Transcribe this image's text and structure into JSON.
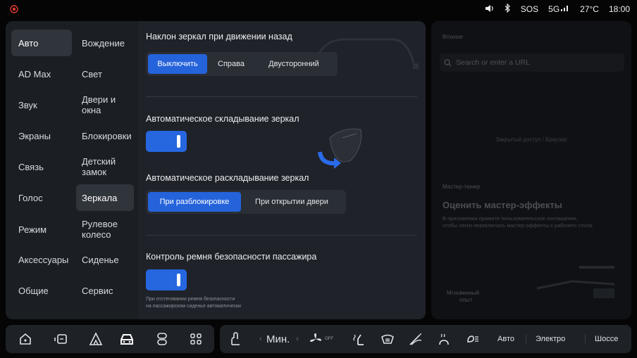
{
  "status": {
    "volume_icon": "volume-icon",
    "bluetooth_icon": "bluetooth-icon",
    "sos": "SOS",
    "network": "5G",
    "temperature": "27°C",
    "time": "18:00"
  },
  "nav_primary": [
    "Авто",
    "AD Max",
    "Звук",
    "Экраны",
    "Связь",
    "Голос",
    "Режим",
    "Аксессуары",
    "Общие"
  ],
  "nav_primary_active": "Авто",
  "nav_secondary": [
    "Вождение",
    "Свет",
    "Двери и окна",
    "Блокировки",
    "Детский замок",
    "Зеркала",
    "Рулевое колесо",
    "Сиденье",
    "Сервис"
  ],
  "nav_secondary_active": "Зеркала",
  "settings": {
    "reverse_tilt": {
      "title": "Наклон зеркал при движении назад",
      "options": [
        "Выключить",
        "Справа",
        "Двусторонний"
      ],
      "selected": "Выключить"
    },
    "auto_fold": {
      "title": "Автоматическое складывание зеркал",
      "enabled": true
    },
    "auto_unfold": {
      "title": "Автоматическое раскладывание зеркал",
      "options": [
        "При разблокировке",
        "При открытии двери"
      ],
      "selected": "При разблокировке"
    },
    "seatbelt": {
      "title": "Контроль ремня безопасности пассажира",
      "enabled": true,
      "note_line1": "При отстегивании ремня безопасности",
      "note_line2": "на пассажирском сиденье автоматически"
    }
  },
  "right_panel": {
    "browser_label": "Browser",
    "search_placeholder": "Search or enter a URL",
    "center_text": "Закрытый доступ / Браузер",
    "wizard_label": "Мастер-тюнер",
    "wizard_title": "Оценить мастер-эффекты",
    "wizard_desc_1": "В приложении примите пользовательское соглашение,",
    "wizard_desc_2": "чтобы легко переключать мастер-эффекты с рабочего стола.",
    "instant_line1": "Мгновенный",
    "instant_line2": "опыт"
  },
  "dock": {
    "fan_speed": "Мин.",
    "fan_prev": "‹",
    "fan_next": "›",
    "fan_off": "OFF",
    "modes": [
      "Авто",
      "Электро",
      "Шоссе"
    ]
  },
  "colors": {
    "accent": "#2563db",
    "panel": "#1b1e23",
    "background": "#050506"
  }
}
